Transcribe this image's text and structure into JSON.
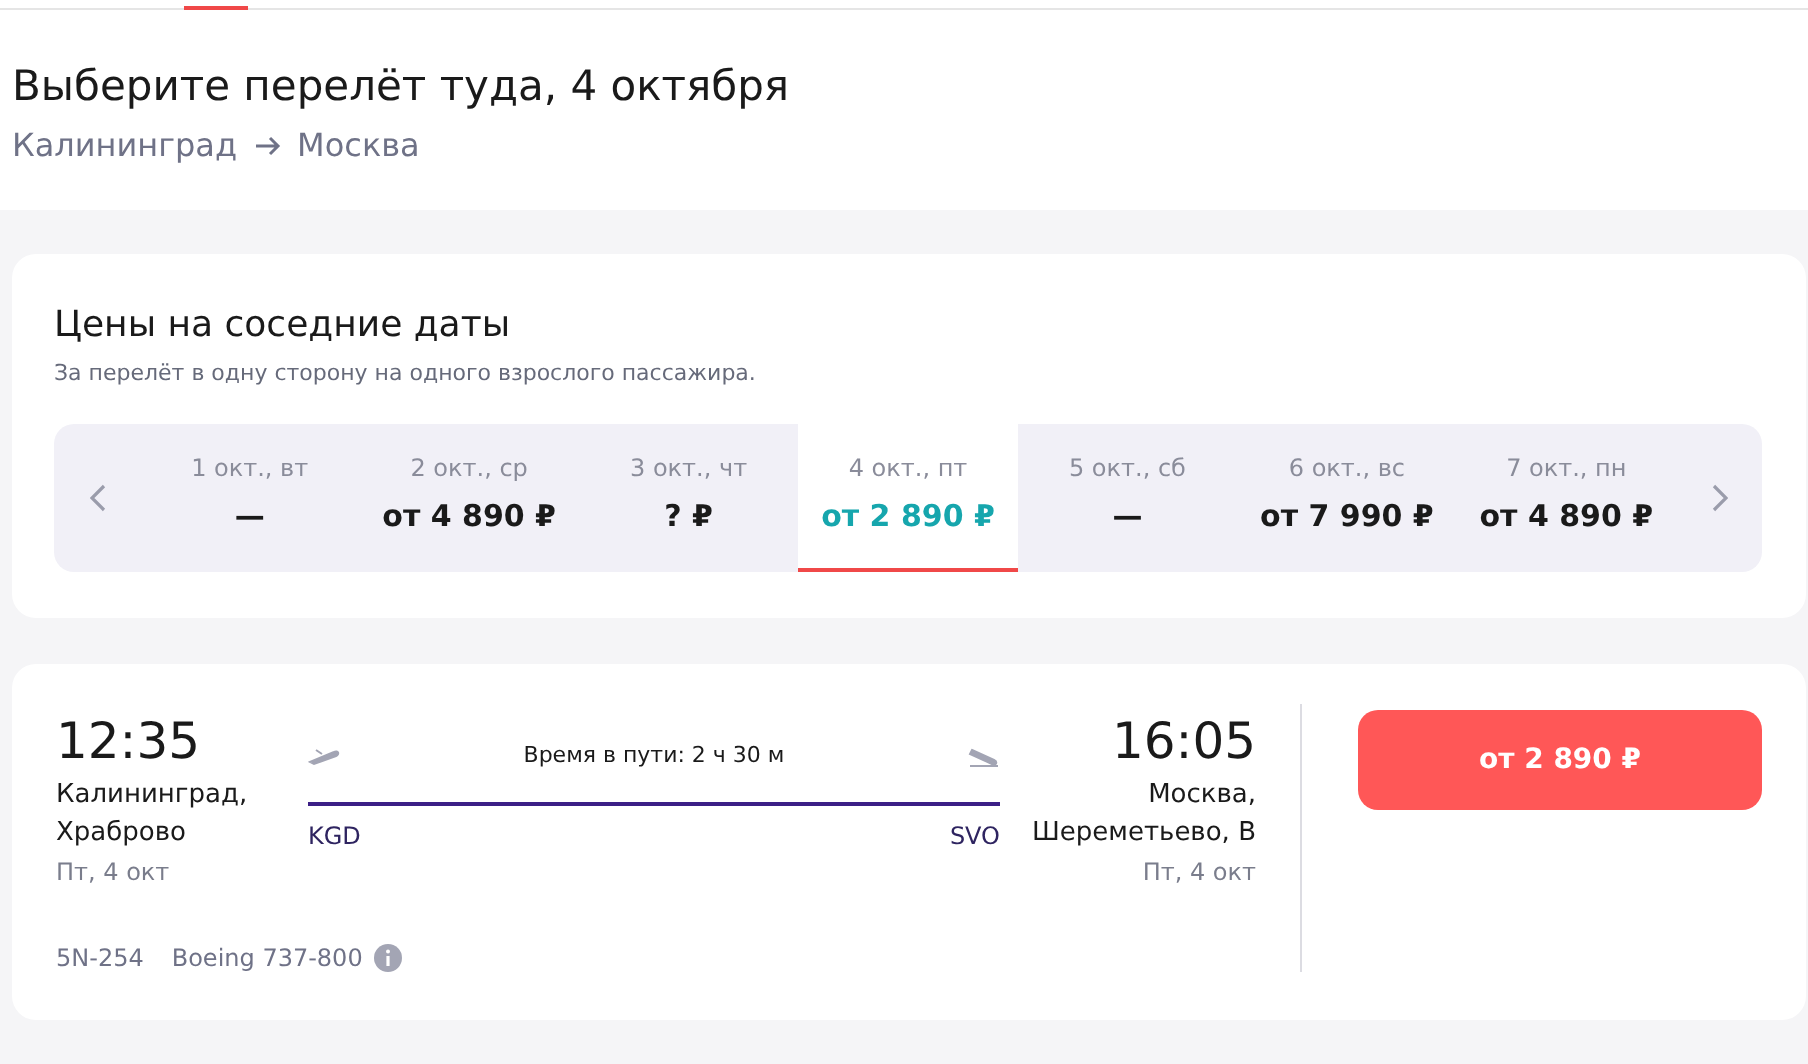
{
  "header": {
    "title": "Выберите перелёт туда, 4 октября",
    "route": {
      "from": "Калининград",
      "to": "Москва"
    }
  },
  "nearby_dates": {
    "title": "Цены на соседние даты",
    "subtitle": "За перелёт в одну сторону на одного взрослого пассажира.",
    "dates": [
      {
        "date": "1 окт., вт",
        "price": "—",
        "selected": false
      },
      {
        "date": "2 окт., ср",
        "price": "от 4 890 ₽",
        "selected": false
      },
      {
        "date": "3 окт., чт",
        "price": "? ₽",
        "selected": false
      },
      {
        "date": "4 окт., пт",
        "price": "от 2 890 ₽",
        "selected": true
      },
      {
        "date": "5 окт., сб",
        "price": "—",
        "selected": false
      },
      {
        "date": "6 окт., вс",
        "price": "от 7 990 ₽",
        "selected": false
      },
      {
        "date": "7 окт., пн",
        "price": "от 4 890 ₽",
        "selected": false
      }
    ]
  },
  "flight": {
    "departure": {
      "time": "12:35",
      "city": "Калининград,",
      "airport": "Храброво",
      "date": "Пт, 4 окт",
      "code": "KGD"
    },
    "duration": "Время в пути: 2 ч 30 м",
    "arrival": {
      "time": "16:05",
      "city": "Москва,",
      "airport": "Шереметьево, B",
      "date": "Пт, 4 окт",
      "code": "SVO"
    },
    "flight_number": "5N-254",
    "aircraft": "Boeing 737-800",
    "price_button": "от 2 890 ₽"
  }
}
